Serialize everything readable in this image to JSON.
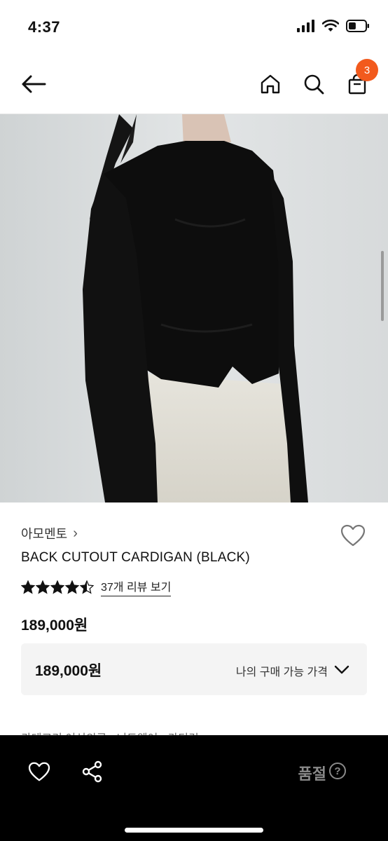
{
  "status_bar": {
    "time": "4:37",
    "battery_level": 0.45
  },
  "nav": {
    "back_icon": "arrow-left-icon",
    "home_icon": "home-icon",
    "search_icon": "search-icon",
    "cart_icon": "shopping-bag-icon",
    "cart_count": "3",
    "badge_color": "#f25a1d"
  },
  "product": {
    "brand": "아모멘토",
    "brand_chevron": "›",
    "name": "BACK CUTOUT CARDIGAN (BLACK)",
    "rating": 4.5,
    "review_link": "37개 리뷰 보기",
    "price": "189,000원",
    "my_price": "189,000원",
    "my_price_label": "나의 구매 가능 가격",
    "breadcrumb": "카테고리    여성의류 › 니트웨어 › 카디건"
  },
  "bottom_bar": {
    "wish_icon": "heart-outline-icon",
    "share_icon": "share-icon",
    "soldout_label": "품절",
    "help_label": "?"
  }
}
